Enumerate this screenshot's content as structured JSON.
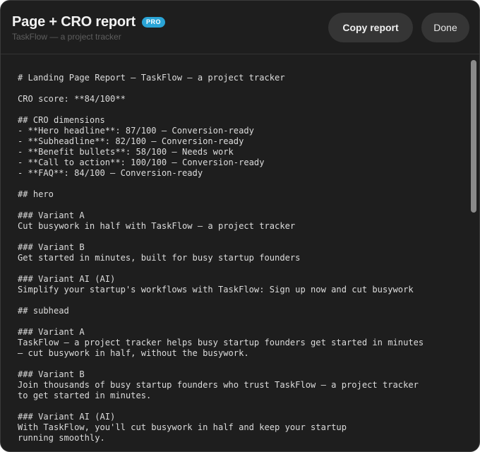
{
  "header": {
    "title": "Page + CRO report",
    "badge": "PRO",
    "subtitle": "TaskFlow — a project tracker",
    "copy_label": "Copy report",
    "done_label": "Done"
  },
  "report_lines": [
    "# Landing Page Report — TaskFlow — a project tracker",
    "",
    "CRO score: **84/100**",
    "",
    "## CRO dimensions",
    "- **Hero headline**: 87/100 — Conversion-ready",
    "- **Subheadline**: 82/100 — Conversion-ready",
    "- **Benefit bullets**: 58/100 — Needs work",
    "- **Call to action**: 100/100 — Conversion-ready",
    "- **FAQ**: 84/100 — Conversion-ready",
    "",
    "## hero",
    "",
    "### Variant A",
    "Cut busywork in half with TaskFlow — a project tracker",
    "",
    "### Variant B",
    "Get started in minutes, built for busy startup founders",
    "",
    "### Variant AI (AI)",
    "Simplify your startup's workflows with TaskFlow: Sign up now and cut busywork",
    "",
    "## subhead",
    "",
    "### Variant A",
    "TaskFlow — a project tracker helps busy startup founders get started in minutes",
    "— cut busywork in half, without the busywork.",
    "",
    "### Variant B",
    "Join thousands of busy startup founders who trust TaskFlow — a project tracker",
    "to get started in minutes.",
    "",
    "### Variant AI (AI)",
    "With TaskFlow, you'll cut busywork in half and keep your startup",
    "running smoothly."
  ],
  "colors": {
    "background": "#1e1e1e",
    "badge": "#2aa4d6",
    "button": "#353535",
    "text": "#dcdcdc"
  }
}
